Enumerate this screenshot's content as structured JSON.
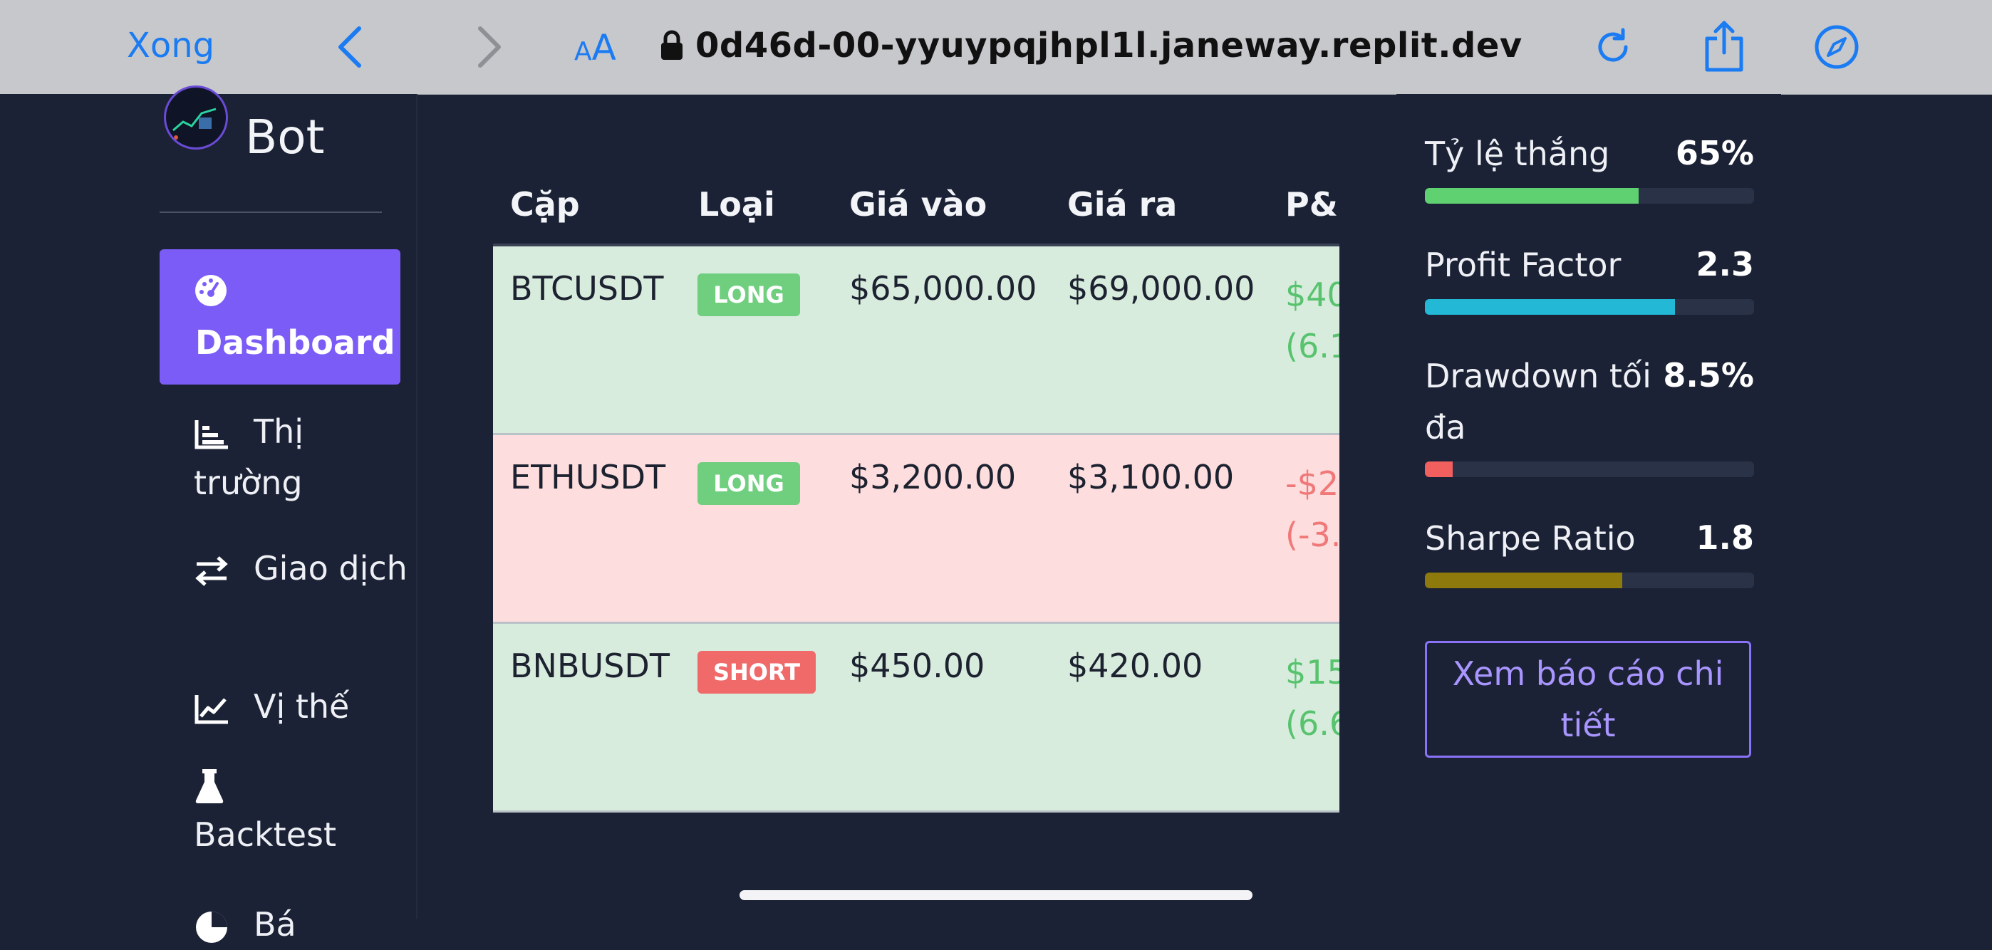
{
  "browser": {
    "done_label": "Xong",
    "aa_small": "A",
    "aa_large": "A",
    "url": "0d46d-00-yyuypqjhpl1l.janeway.replit.dev"
  },
  "sidebar": {
    "brand": "Bot",
    "items": [
      {
        "label": "Dashboard",
        "icon": "gauge-icon"
      },
      {
        "label": "Thị trường",
        "icon": "bar-chart-icon"
      },
      {
        "label": "Giao dịch",
        "icon": "exchange-icon"
      },
      {
        "label": "Vị thế",
        "icon": "line-chart-icon"
      },
      {
        "label": "Backtest",
        "icon": "flask-icon"
      },
      {
        "label": "Bá",
        "icon": "pie-chart-icon"
      }
    ]
  },
  "table": {
    "headers": [
      "Cặp",
      "Loại",
      "Giá vào",
      "Giá ra",
      "P&L"
    ],
    "rows": [
      {
        "pair": "BTCUSDT",
        "type": "LONG",
        "entry": "$65,000.00",
        "exit": "$69,000.00",
        "pnl": "$40",
        "pnl_pct": "(6.1",
        "result": "win"
      },
      {
        "pair": "ETHUSDT",
        "type": "LONG",
        "entry": "$3,200.00",
        "exit": "$3,100.00",
        "pnl": "-$2",
        "pnl_pct": "(-3.",
        "result": "loss"
      },
      {
        "pair": "BNBUSDT",
        "type": "SHORT",
        "entry": "$450.00",
        "exit": "$420.00",
        "pnl": "$15",
        "pnl_pct": "(6.6",
        "result": "win"
      }
    ]
  },
  "stats": {
    "items": [
      {
        "label": "Tỷ lệ thắng",
        "value": "65%",
        "level": 0.65,
        "color": "#5fd170"
      },
      {
        "label": "Profit Factor",
        "value": "2.3",
        "level": 0.76,
        "color": "#22b8d6"
      },
      {
        "label": "Drawdown tối đa",
        "value": "8.5%",
        "level": 0.085,
        "color": "#f25f5f"
      },
      {
        "label": "Sharpe Ratio",
        "value": "1.8",
        "level": 0.6,
        "color": "#8e7a0c"
      }
    ],
    "report_button": "Xem báo cáo chi tiết"
  },
  "colors": {
    "background": "#1b2235",
    "accent": "#7b5cf6",
    "link": "#1a7bf2"
  }
}
